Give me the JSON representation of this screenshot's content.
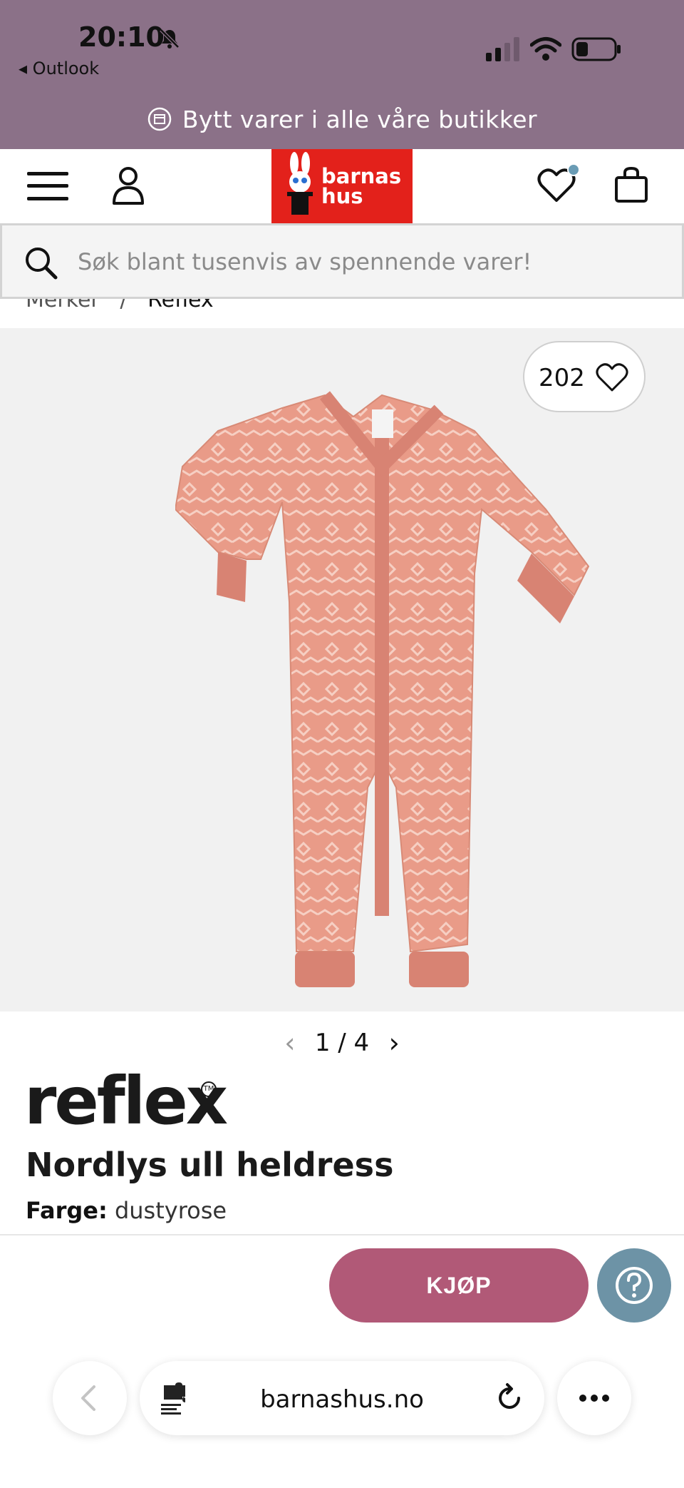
{
  "status_bar": {
    "time": "20:10",
    "back_app": "◂ Outlook"
  },
  "promo": {
    "text": "Bytt varer i alle våre butikker"
  },
  "header": {
    "logo_line1": "barnas",
    "logo_line2": "hus"
  },
  "search": {
    "placeholder": "Søk blant tusenvis av spennende varer!"
  },
  "breadcrumb": {
    "parent": "Merker",
    "separator": "/",
    "current": "Reflex"
  },
  "product": {
    "favorite_count": "202",
    "gallery_current": "1",
    "gallery_separator": "/",
    "gallery_total": "4",
    "brand": "reflex",
    "title": "Nordlys ull heldress",
    "color_label": "Farge:",
    "color_value": "dustyrose",
    "buy_label": "KJØP"
  },
  "browser": {
    "url": "barnashus.no"
  },
  "colors": {
    "header_bg": "#8b7188",
    "logo_red": "#e3211b",
    "buy_button": "#b15977",
    "help_button": "#6d93a6",
    "garment": "#e89a86"
  }
}
